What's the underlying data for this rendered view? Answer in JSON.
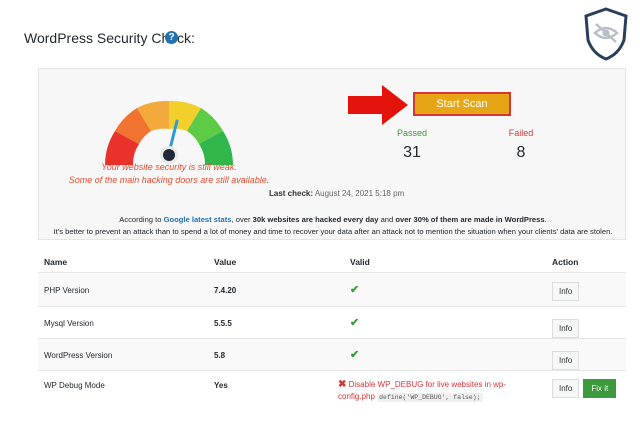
{
  "header": {
    "title": "WordPress Security Check:",
    "help_icon": "question-circle-icon",
    "logo_icon": "eye-slash-shield-icon"
  },
  "scan": {
    "gauge_icon": "speedometer-icon",
    "gauge_colors": [
      "#e8322b",
      "#f07430",
      "#f3a93c",
      "#f3cf2c",
      "#5ecb47",
      "#30b64a"
    ],
    "message_line1": "Your website security is still weak.",
    "message_line2": "Some of the main hacking doors are still available.",
    "start_button": "Start Scan",
    "passed_label": "Passed",
    "passed_value": "31",
    "failed_label": "Failed",
    "failed_value": "8",
    "last_check_label": "Last check:",
    "last_check_value": "August 24, 2021 5:18 pm",
    "info_prefix": "According to ",
    "info_link": "Google latest stats",
    "info_mid1": ", over ",
    "info_bold1": "30k websites are hacked every day",
    "info_mid2": " and ",
    "info_bold2": "over 30% of them are made in WordPress",
    "info_end": ".",
    "info_line2": "It's better to prevent an attack than to spend a lot of money and time to recover your data after an attack not to mention the situation when your clients' data are stolen.",
    "accent_color": "#e5a514",
    "arrow_color": "#e3120b"
  },
  "table": {
    "headers": {
      "name": "Name",
      "value": "Value",
      "valid": "Valid",
      "action": "Action"
    },
    "rows": [
      {
        "name": "PHP Version",
        "value": "7.4.20",
        "valid": "✔",
        "action": "Info"
      },
      {
        "name": "Mysql Version",
        "value": "5.5.5",
        "valid": "✔",
        "action": "Info"
      },
      {
        "name": "WordPress Version",
        "value": "5.8",
        "valid": "✔",
        "action": "Info"
      },
      {
        "name": "WP Debug Mode",
        "value": "Yes",
        "valid": "✖",
        "message": "Disable WP_DEBUG for live websites in wp-config.php",
        "code": "define('WP_DEBUG', false);",
        "action": "Info",
        "fix": "Fix it"
      }
    ]
  }
}
